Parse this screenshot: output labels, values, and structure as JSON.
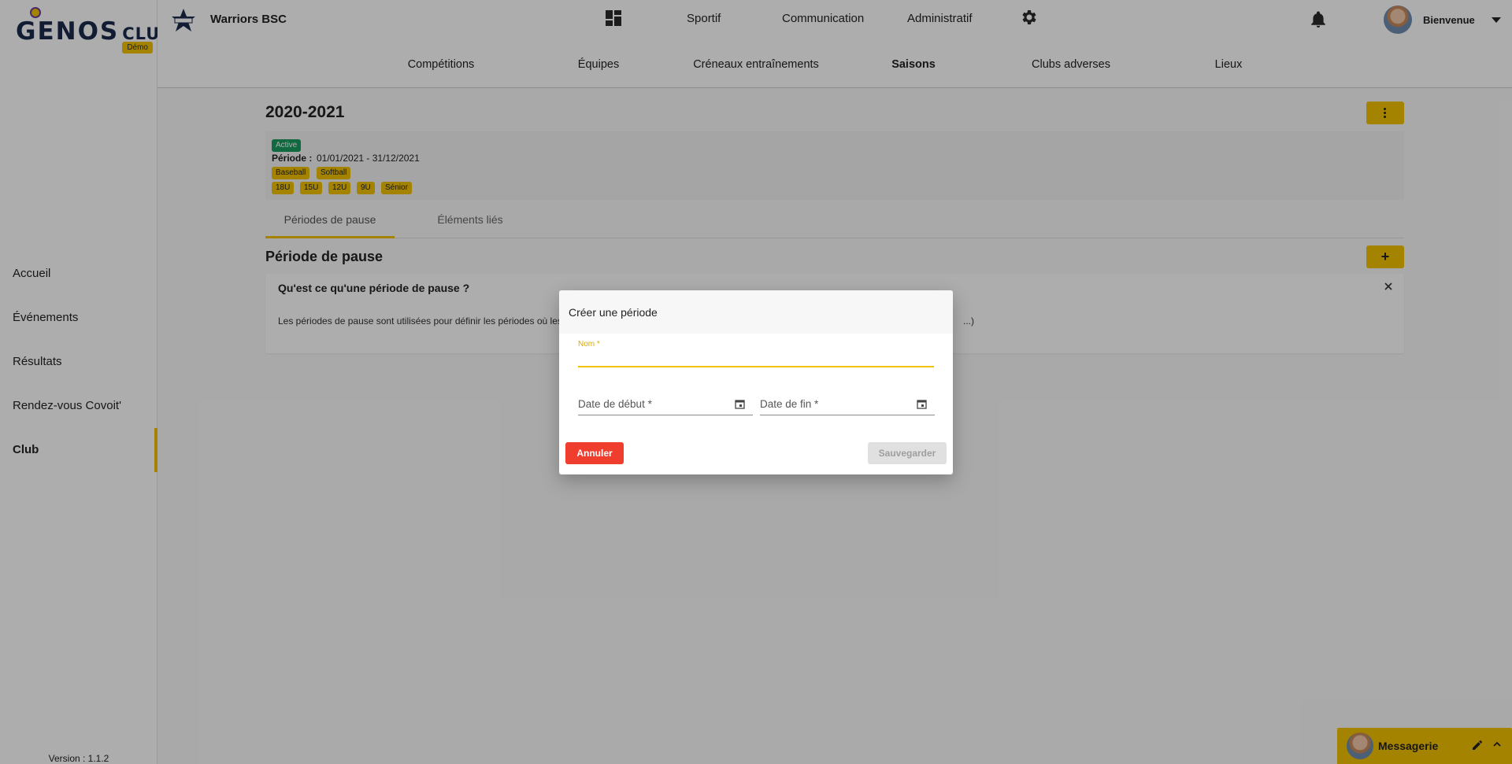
{
  "sidebar": {
    "logo_main": "GENOS",
    "logo_sub": "CLUBS",
    "logo_badge": "Démo",
    "items": [
      {
        "label": "Accueil"
      },
      {
        "label": "Événements"
      },
      {
        "label": "Résultats"
      },
      {
        "label": "Rendez-vous Covoit'"
      },
      {
        "label": "Club",
        "active": true
      }
    ],
    "version": "Version : 1.1.2"
  },
  "header": {
    "club_name": "Warriors BSC",
    "nav": [
      "Sportif",
      "Communication",
      "Administratif"
    ],
    "user_greeting": "Bienvenue",
    "icons": [
      "dashboard-icon",
      "gear-icon",
      "bell-icon",
      "avatar",
      "caret-down-icon"
    ]
  },
  "subnav": {
    "items": [
      {
        "label": "Compétitions"
      },
      {
        "label": "Équipes"
      },
      {
        "label": "Créneaux entraînements"
      },
      {
        "label": "Saisons",
        "active": true
      },
      {
        "label": "Clubs adverses"
      },
      {
        "label": "Lieux"
      }
    ]
  },
  "season": {
    "title": "2020-2021",
    "status": "Active",
    "period_label": "Période :",
    "period_value": "01/01/2021 - 31/12/2021",
    "sports": [
      "Baseball",
      "Softball"
    ],
    "categories": [
      "18U",
      "15U",
      "12U",
      "9U",
      "Sénior"
    ]
  },
  "tabs": [
    {
      "label": "Périodes de pause",
      "active": true
    },
    {
      "label": "Éléments liés"
    }
  ],
  "pause": {
    "title": "Période de pause",
    "plus_label": "+",
    "info_title": "Qu'est ce qu'une période de pause ?",
    "info_text_left": "Les périodes de pause sont utilisées pour définir les périodes où les",
    "info_text_right": "...)"
  },
  "messagerie": {
    "label": "Messagerie"
  },
  "modal": {
    "title": "Créer une période",
    "name_label": "Nom",
    "required_mark": "*",
    "name_value": "",
    "start_label": "Date de début *",
    "end_label": "Date de fin *",
    "cancel_label": "Annuler",
    "save_label": "Sauvegarder"
  },
  "colors": {
    "accent": "#f2c200",
    "active_badge": "#1a9b5d",
    "cancel": "#f03e2e",
    "disabled": "#e0e0e0"
  }
}
